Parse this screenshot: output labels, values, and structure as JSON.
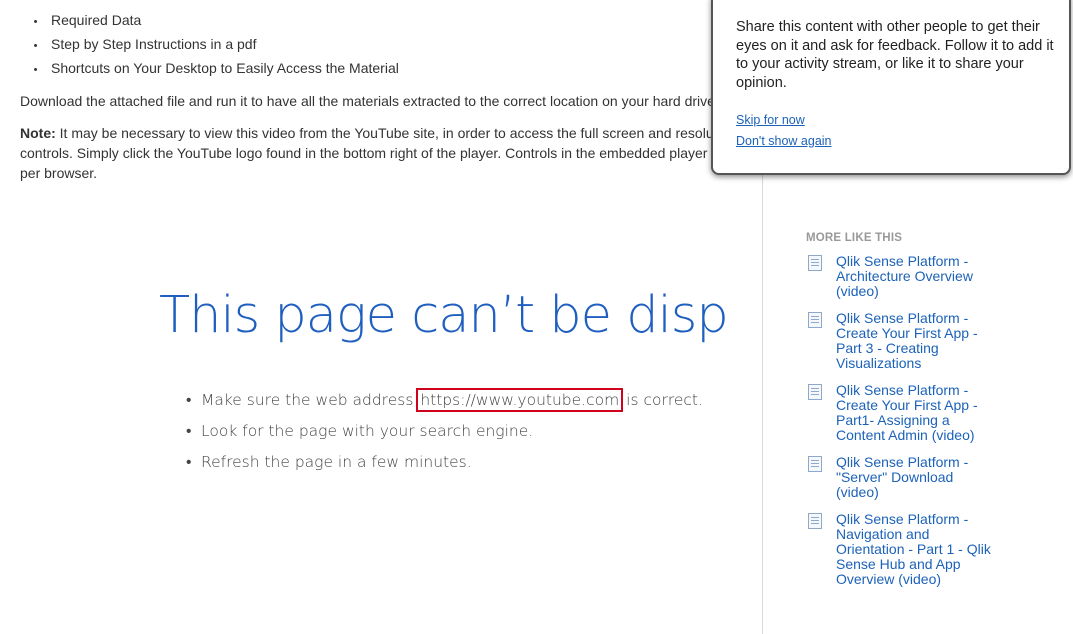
{
  "content": {
    "bullets": [
      "Required Data",
      "Step by Step Instructions in a pdf",
      "Shortcuts on Your Desktop to Easily Access the Material"
    ],
    "download_text": "Download the attached file and run it to have all the materials extracted to the correct location on your hard drive.",
    "note_label": "Note:",
    "note_text": " It may be necessary to view this video from the YouTube site, in order to access the full screen and resolution controls. Simply click the YouTube logo found in the bottom right of the player. Controls in the embedded player vary per browser."
  },
  "error": {
    "title": "This page can’t be displayed",
    "items": [
      {
        "before": "Make sure the web address ",
        "url": "https://www.youtube.com",
        "after": " is correct."
      },
      {
        "text": "Look for the page with your search engine."
      },
      {
        "text": "Refresh the page in a few minutes."
      }
    ],
    "highlight_color": "#d0021b"
  },
  "sidebar": {
    "title": "MORE LIKE THIS",
    "items": [
      {
        "label": "Qlik Sense Platform - Architecture Overview (video)"
      },
      {
        "label": "Qlik Sense Platform - Create Your First App - Part 3 - Creating Visualizations"
      },
      {
        "label": "Qlik Sense Platform - Create Your First App - Part1- Assigning a Content Admin  (video)"
      },
      {
        "label": "Qlik Sense Platform - \"Server\" Download (video)"
      },
      {
        "label": "Qlik Sense Platform - Navigation and Orientation - Part 1 - Qlik Sense Hub and App Overview (video)"
      }
    ]
  },
  "popup": {
    "text": "Share this content with other people to get their eyes on it and ask for feedback. Follow it to add it to your activity stream, or like it to share your opinion.",
    "skip_label": "Skip for now",
    "dont_show_label": "Don't show again"
  },
  "colors": {
    "link": "#1c62b9",
    "error_title": "#1f5fbf"
  }
}
